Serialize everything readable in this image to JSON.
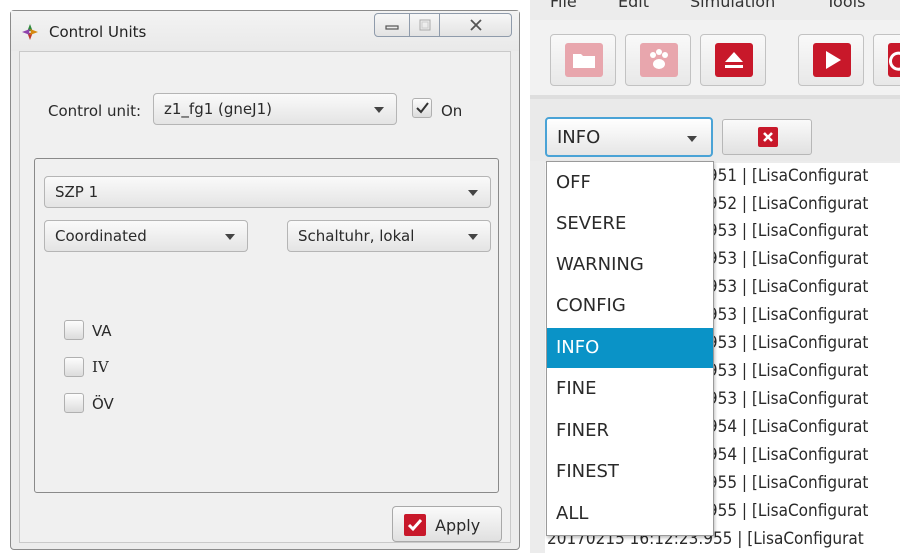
{
  "control_units_dialog": {
    "title": "Control Units",
    "control_unit_label": "Control unit:",
    "control_unit_value": "z1_fg1 (gneJ1)",
    "on_label": "On",
    "on_checked": true,
    "program_value": "SZP 1",
    "mode_value": "Coordinated",
    "schedule_value": "Schaltuhr, lokal",
    "checkboxes": [
      {
        "label": "VA",
        "checked": false
      },
      {
        "label": "IV",
        "checked": false
      },
      {
        "label": "ÖV",
        "checked": false
      }
    ],
    "apply_label": "Apply"
  },
  "main_window": {
    "menu": [
      "File",
      "Edit",
      "Simulation",
      "Tools"
    ],
    "toolbar_icons": [
      "folder-icon",
      "paw-icon",
      "eject-icon",
      "play-icon",
      "reload-icon"
    ],
    "log_level": {
      "selected": "INFO",
      "options": [
        "OFF",
        "SEVERE",
        "WARNING",
        "CONFIG",
        "INFO",
        "FINE",
        "FINER",
        "FINEST",
        "ALL"
      ]
    },
    "log_lines": [
      ".951 | [LisaConfigurat",
      ".952 | [LisaConfigurat",
      ".953 | [LisaConfigurat",
      ".953 | [LisaConfigurat",
      ".953 | [LisaConfigurat",
      ".953 | [LisaConfigurat",
      ".953 | [LisaConfigurat",
      ".953 | [LisaConfigurat",
      ".953 | [LisaConfigurat",
      ".954 | [LisaConfigurat",
      ".954 | [LisaConfigurat",
      ".955 | [LisaConfigurat",
      ".955 | [LisaConfigurat"
    ],
    "last_log_line": "20170215 16:12:23.955 | [LisaConfigurat"
  },
  "colors": {
    "accent": "#0a93c7",
    "danger": "#c8182a",
    "focus_border": "#4aa3d6"
  }
}
